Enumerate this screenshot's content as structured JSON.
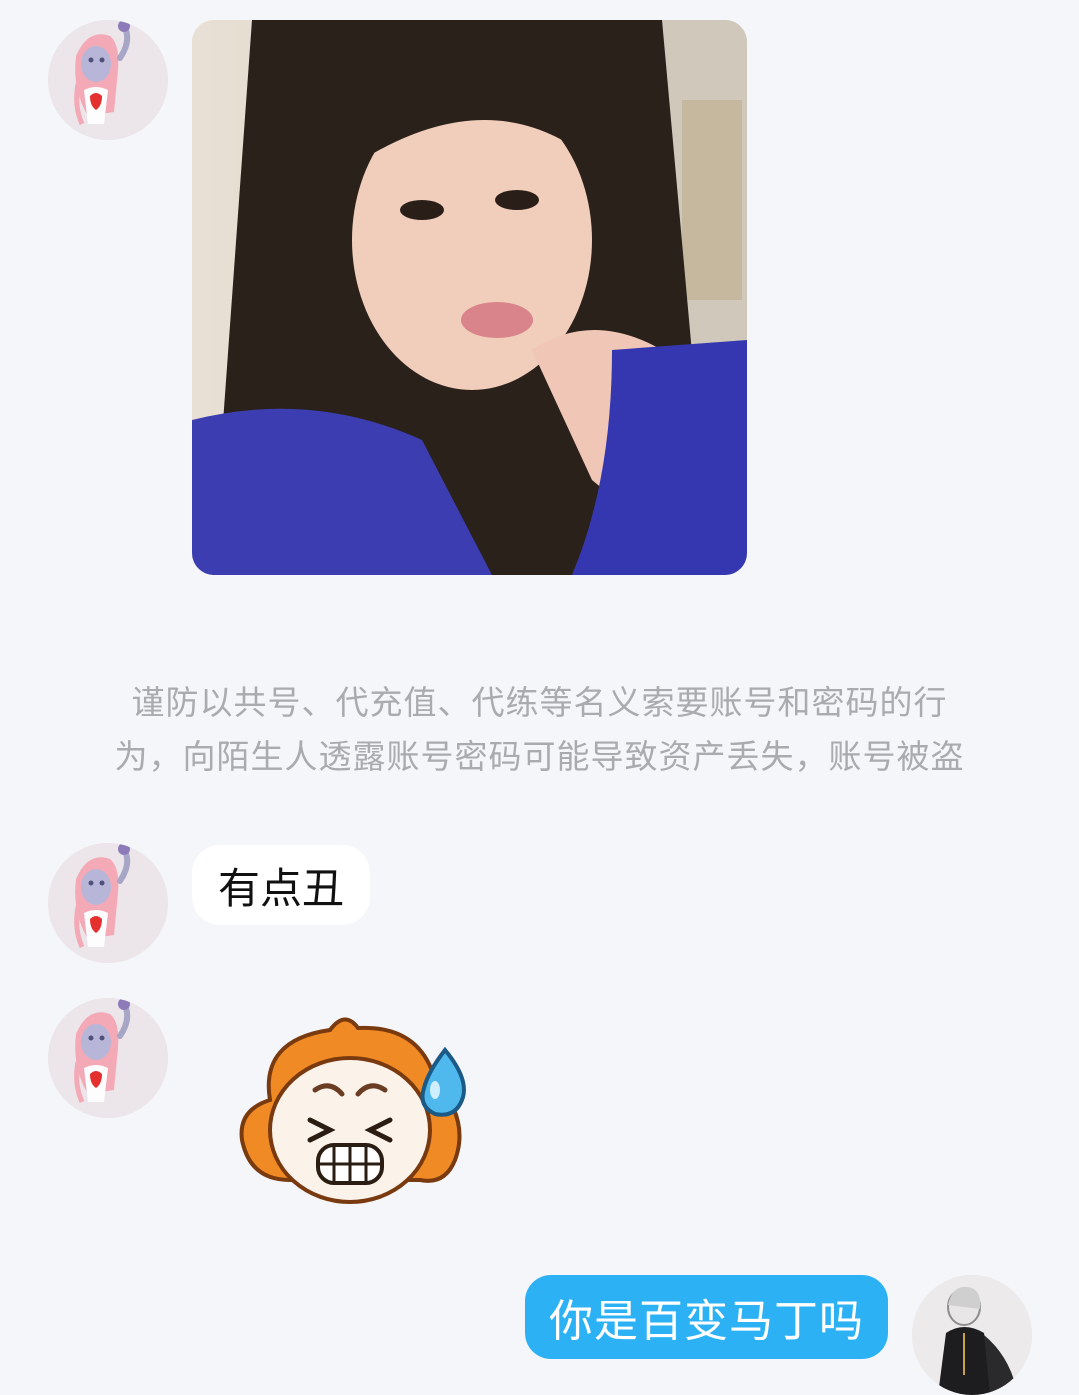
{
  "messages": [
    {
      "id": "m1",
      "direction": "incoming",
      "type": "image",
      "avatar_icon": "anime-girl-avatar-icon"
    },
    {
      "id": "m2",
      "direction": "system",
      "type": "notice",
      "line1": "谨防以共号、代充值、代练等名义索要账号和密码的行",
      "line2": "为，向陌生人透露账号密码可能导致资产丢失，账号被盗"
    },
    {
      "id": "m3",
      "direction": "incoming",
      "type": "text",
      "text": "有点丑",
      "avatar_icon": "anime-girl-avatar-icon"
    },
    {
      "id": "m4",
      "direction": "incoming",
      "type": "sticker",
      "sticker_icon": "sweat-grimace-emoji-icon",
      "avatar_icon": "anime-girl-avatar-icon"
    },
    {
      "id": "m5",
      "direction": "outgoing",
      "type": "text",
      "text": "你是百变马丁吗",
      "avatar_icon": "dark-figure-avatar-icon"
    }
  ],
  "colors": {
    "background": "#f4f6f9",
    "incoming_bubble": "#ffffff",
    "outgoing_bubble": "#2db1f5",
    "notice_text": "#a9abaf"
  }
}
